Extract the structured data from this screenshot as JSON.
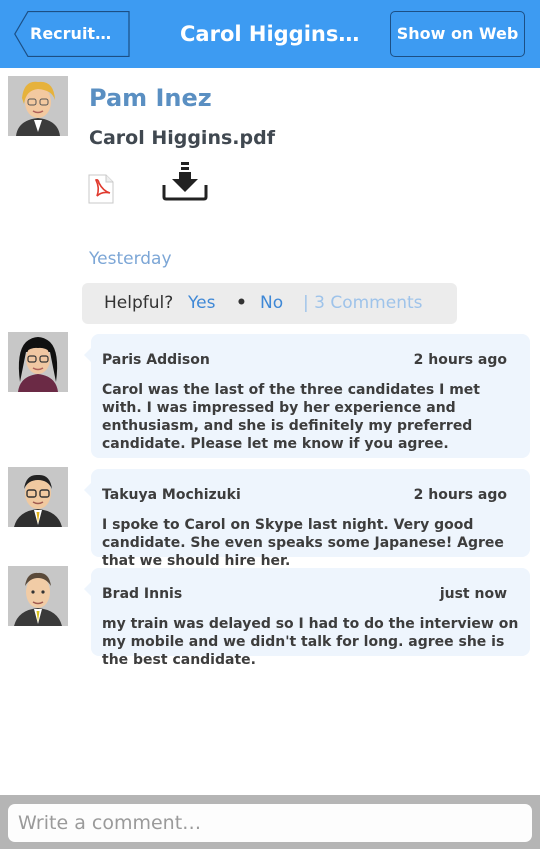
{
  "header": {
    "back_label": "Recruitme…",
    "title": "Carol Higgins.…",
    "web_button_label": "Show on Web"
  },
  "colors": {
    "header_bg": "#3d9bf2",
    "author": "#5a8fc2",
    "link": "#3f88d6",
    "comment_bubble": "#eef5fd"
  },
  "post": {
    "author": "Pam Inez",
    "file_name": "Carol Higgins.pdf",
    "file_icon": "pdf-icon",
    "download_icon": "download-icon",
    "date": "Yesterday",
    "helpful": {
      "label": "Helpful?",
      "yes": "Yes",
      "separator": "•",
      "no": "No",
      "comments": "| 3 Comments"
    }
  },
  "comments": [
    {
      "author": "Paris Addison",
      "time": "2 hours ago",
      "text": "Carol was the last of the three candidates I met with. I was impressed by her experience and enthusiasm, and she is definitely my preferred candidate. Please let me know if you agree."
    },
    {
      "author": "Takuya Mochizuki",
      "time": "2 hours ago",
      "text": "I spoke to Carol on Skype last night. Very good candidate. She even speaks some Japanese! Agree that we should hire her."
    },
    {
      "author": "Brad Innis",
      "time": "just now",
      "text": "my train was delayed so I had to do the interview on my mobile and we didn't talk for long. agree she is the best candidate."
    }
  ],
  "composer": {
    "placeholder": "Write a comment…"
  }
}
